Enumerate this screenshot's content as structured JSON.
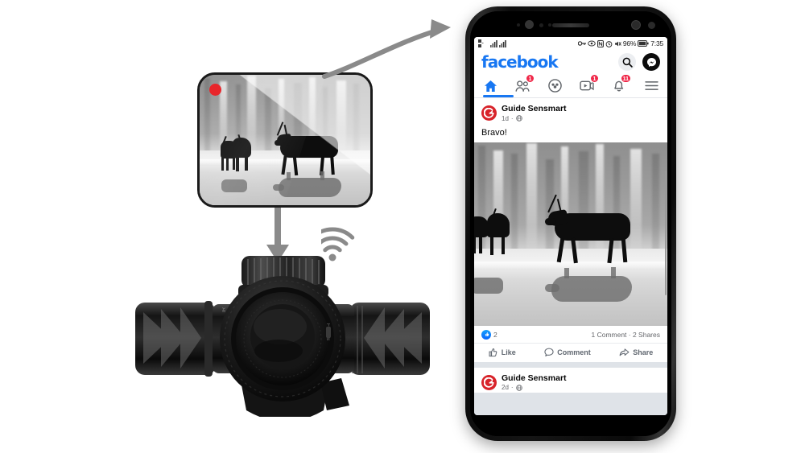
{
  "scene": {
    "title": "Thermal riflescope streaming to Facebook on smartphone",
    "wifi_icon": "wifi-signal-icon",
    "arrow_curve": "curved-arrow-to-phone",
    "arrow_down": "down-arrow-to-scope"
  },
  "thermal_card": {
    "rec_indicator": "recording-dot",
    "caption": "thermal-preview-deer-forest",
    "accent_red": "#e8262b"
  },
  "phone": {
    "statusbar": {
      "sim_icons": "dual-sim-signal-icons",
      "key_icon": "vpn-key-icon",
      "eye_icon": "eye-icon",
      "n_icon": "nfc-icon",
      "alarm_icon": "alarm-icon",
      "mute_icon": "mute-icon",
      "battery_percent": "96%",
      "battery_icon": "battery-full-icon",
      "time": "7:35"
    },
    "header": {
      "wordmark": "facebook",
      "brand_color": "#1877f2",
      "search_icon": "search-icon",
      "messenger_icon": "messenger-icon"
    },
    "tabs": [
      {
        "name": "home",
        "icon": "home-icon",
        "badge": "",
        "active": true
      },
      {
        "name": "friends",
        "icon": "friends-icon",
        "badge": "1",
        "active": false
      },
      {
        "name": "groups",
        "icon": "groups-icon",
        "badge": "",
        "active": false
      },
      {
        "name": "watch",
        "icon": "video-play-icon",
        "badge": "1",
        "active": false
      },
      {
        "name": "notifications",
        "icon": "bell-icon",
        "badge": "11",
        "active": false
      },
      {
        "name": "menu",
        "icon": "hamburger-menu-icon",
        "badge": "",
        "active": false
      }
    ],
    "posts": [
      {
        "author": "Guide Sensmart",
        "avatar_letter": "G",
        "time": "1d",
        "privacy_icon": "globe-icon",
        "text": "Bravo!",
        "image": "thermal-deer-forest-photo",
        "reactions_count": "2",
        "reaction_icon": "like-reaction-icon",
        "comments_shares": "1 Comment · 2 Shares",
        "actions": [
          {
            "label": "Like",
            "icon": "thumbs-up-icon"
          },
          {
            "label": "Comment",
            "icon": "comment-bubble-icon"
          },
          {
            "label": "Share",
            "icon": "share-arrow-icon"
          }
        ]
      },
      {
        "author": "Guide Sensmart",
        "avatar_letter": "G",
        "time": "2d",
        "privacy_icon": "globe-icon"
      }
    ]
  },
  "scope": {
    "name": "thermal-riflescope",
    "body_color": "#111111"
  },
  "colors": {
    "fb_blue": "#1877f2",
    "badge_red": "#f02849",
    "brand_red": "#d8232a",
    "arrow_gray": "#8a8a8a"
  }
}
